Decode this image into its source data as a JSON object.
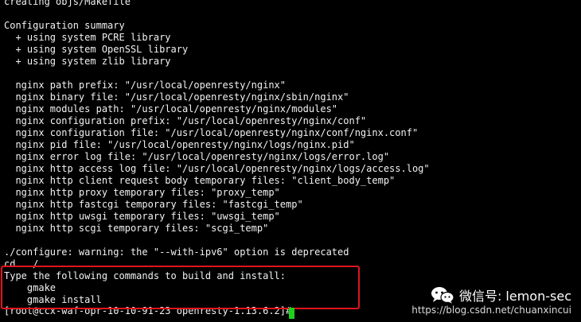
{
  "terminal": {
    "lines": [
      "creating objs/Makefile",
      "",
      "Configuration summary",
      "  + using system PCRE library",
      "  + using system OpenSSL library",
      "  + using system zlib library",
      "",
      "  nginx path prefix: \"/usr/local/openresty/nginx\"",
      "  nginx binary file: \"/usr/local/openresty/nginx/sbin/nginx\"",
      "  nginx modules path: \"/usr/local/openresty/nginx/modules\"",
      "  nginx configuration prefix: \"/usr/local/openresty/nginx/conf\"",
      "  nginx configuration file: \"/usr/local/openresty/nginx/conf/nginx.conf\"",
      "  nginx pid file: \"/usr/local/openresty/nginx/logs/nginx.pid\"",
      "  nginx error log file: \"/usr/local/openresty/nginx/logs/error.log\"",
      "  nginx http access log file: \"/usr/local/openresty/nginx/logs/access.log\"",
      "  nginx http client request body temporary files: \"client_body_temp\"",
      "  nginx http proxy temporary files: \"proxy_temp\"",
      "  nginx http fastcgi temporary files: \"fastcgi_temp\"",
      "  nginx http uwsgi temporary files: \"uwsgi_temp\"",
      "  nginx http scgi temporary files: \"scgi_temp\"",
      "",
      "./configure: warning: the \"--with-ipv6\" option is deprecated",
      "cd ../..",
      "Type the following commands to build and install:",
      "    gmake",
      "    gmake install",
      "[root@ccx-waf-opr-10-10-91-23 openresty-1.13.6.2]# "
    ],
    "colors": {
      "background": "#000000",
      "text": "#f2f2f2",
      "highlight_border": "#e0141e",
      "cursor": "#1cd31c"
    }
  },
  "watermark": {
    "handle": "微信号: lemon-sec",
    "url": "https://blog.csdn.net/chuanxincui",
    "icon": "wechat-icon"
  }
}
